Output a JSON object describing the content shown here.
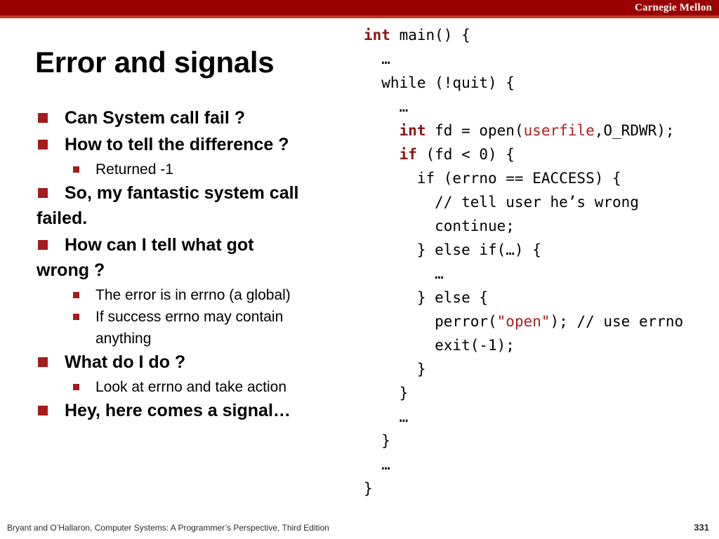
{
  "header": {
    "institution": "Carnegie Mellon"
  },
  "slide": {
    "title": "Error and signals",
    "bullets": [
      {
        "level": 1,
        "lines": [
          "Can System call fail ?"
        ]
      },
      {
        "level": 1,
        "lines": [
          "How to tell the difference ?"
        ]
      },
      {
        "level": 2,
        "lines": [
          "Returned -1"
        ]
      },
      {
        "level": 1,
        "lines": [
          "So, my fantastic system call",
          "failed."
        ]
      },
      {
        "level": 1,
        "lines": [
          "How can I tell what got",
          "wrong ?"
        ]
      },
      {
        "level": 2,
        "lines": [
          "The error is in errno (a global)"
        ]
      },
      {
        "level": 2,
        "lines": [
          "If success errno may contain",
          "anything"
        ]
      },
      {
        "level": 1,
        "lines": [
          "What do I do ?"
        ]
      },
      {
        "level": 2,
        "lines": [
          "Look at errno and take action"
        ]
      },
      {
        "level": 1,
        "lines": [
          "Hey, here comes a signal…"
        ]
      }
    ]
  },
  "code": {
    "language": "c",
    "lines": [
      [
        {
          "t": "int",
          "c": "kw"
        },
        {
          "t": " main() {",
          "c": ""
        }
      ],
      [
        {
          "t": "  …",
          "c": ""
        }
      ],
      [
        {
          "t": "  while (!quit) {",
          "c": ""
        }
      ],
      [
        {
          "t": "    …",
          "c": ""
        }
      ],
      [
        {
          "t": "    ",
          "c": ""
        },
        {
          "t": "int",
          "c": "kw"
        },
        {
          "t": " fd = open(",
          "c": ""
        },
        {
          "t": "userfile",
          "c": "id"
        },
        {
          "t": ",O_RDWR);",
          "c": ""
        }
      ],
      [
        {
          "t": "    ",
          "c": ""
        },
        {
          "t": "if",
          "c": "kw"
        },
        {
          "t": " (fd < 0) {",
          "c": ""
        }
      ],
      [
        {
          "t": "      if (errno == EACCESS) {",
          "c": ""
        }
      ],
      [
        {
          "t": "        // tell user he’s wrong",
          "c": ""
        }
      ],
      [
        {
          "t": "        continue;",
          "c": ""
        }
      ],
      [
        {
          "t": "      } else if(…) {",
          "c": ""
        }
      ],
      [
        {
          "t": "        …",
          "c": ""
        }
      ],
      [
        {
          "t": "      } else {",
          "c": ""
        }
      ],
      [
        {
          "t": "        perror(",
          "c": ""
        },
        {
          "t": "\"open\"",
          "c": "str"
        },
        {
          "t": "); // use errno",
          "c": ""
        }
      ],
      [
        {
          "t": "        exit(-1);",
          "c": ""
        }
      ],
      [
        {
          "t": "      }",
          "c": ""
        }
      ],
      [
        {
          "t": "    }",
          "c": ""
        }
      ],
      [
        {
          "t": "    …",
          "c": ""
        }
      ],
      [
        {
          "t": "  }",
          "c": ""
        }
      ],
      [
        {
          "t": "  …",
          "c": ""
        }
      ],
      [
        {
          "t": "}",
          "c": ""
        }
      ]
    ]
  },
  "footer": {
    "attribution": "Bryant and O’Hallaron, Computer Systems: A Programmer’s Perspective, Third Edition",
    "page_number": "331"
  },
  "colors": {
    "brand_red": "#990000",
    "accent_rule": "#c0392b",
    "bullet_marker": "#A61C1C",
    "code_keyword": "#8F1616",
    "code_identifier": "#B32020",
    "code_string": "#A52020",
    "text": "#000000",
    "background": "#ffffff"
  }
}
